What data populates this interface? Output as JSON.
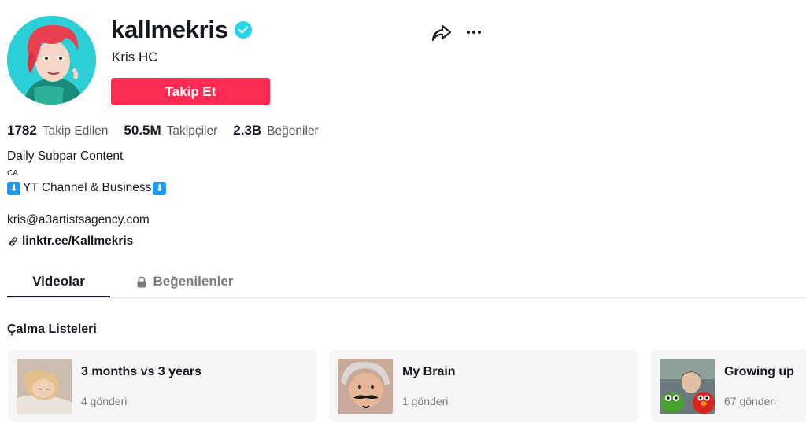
{
  "profile": {
    "username": "kallmekris",
    "display_name": "Kris HC",
    "verified": true,
    "avatar_icon": "cartoon-avatar"
  },
  "actions": {
    "follow_label": "Takip Et",
    "share_icon": "share-icon",
    "more_icon": "more-icon"
  },
  "stats": {
    "following": {
      "value": "1782",
      "label": "Takip Edilen"
    },
    "followers": {
      "value": "50.5M",
      "label": "Takipçiler"
    },
    "likes": {
      "value": "2.3B",
      "label": "Beğeniler"
    }
  },
  "bio": {
    "line1": "Daily Subpar Content",
    "line2": "CA",
    "line3_text": "YT Channel & Business",
    "line3_emoji": "⬇",
    "email": "kris@a3artistsagency.com",
    "link": "linktr.ee/Kallmekris"
  },
  "tabs": [
    {
      "label": "Videolar",
      "active": true
    },
    {
      "label": "Beğenilenler",
      "active": false,
      "locked": true
    }
  ],
  "playlists_section": {
    "title": "Çalma Listeleri",
    "items": [
      {
        "title": "3 months vs 3 years",
        "count": "4 gönderi"
      },
      {
        "title": "My Brain",
        "count": "1 gönderi"
      },
      {
        "title": "Growing up",
        "count": "67 gönderi"
      }
    ]
  },
  "colors": {
    "accent": "#fe2c55",
    "verified": "#20d5ec",
    "text": "#161823",
    "muted": "#55575e"
  }
}
